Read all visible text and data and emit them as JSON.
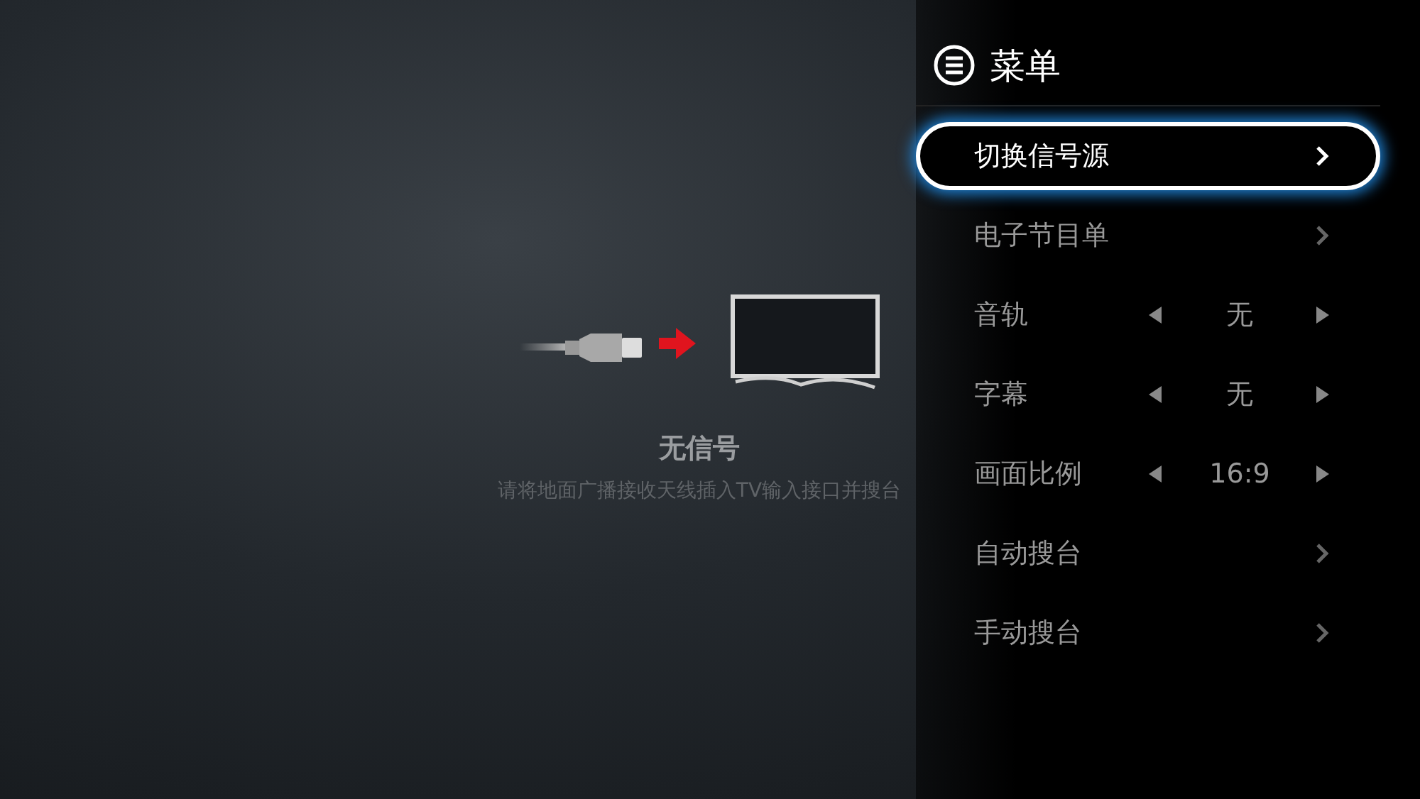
{
  "status": {
    "title": "无信号",
    "hint": "请将地面广播接收天线插入TV输入接口并搜台"
  },
  "menu": {
    "title": "菜单",
    "items": [
      {
        "label": "切换信号源",
        "kind": "submenu",
        "selected": true
      },
      {
        "label": "电子节目单",
        "kind": "submenu",
        "selected": false
      },
      {
        "label": "音轨",
        "kind": "option",
        "value": "无",
        "selected": false
      },
      {
        "label": "字幕",
        "kind": "option",
        "value": "无",
        "selected": false
      },
      {
        "label": "画面比例",
        "kind": "option",
        "value": "16:9",
        "selected": false
      },
      {
        "label": "自动搜台",
        "kind": "submenu",
        "selected": false
      },
      {
        "label": "手动搜台",
        "kind": "submenu",
        "selected": false
      }
    ]
  }
}
